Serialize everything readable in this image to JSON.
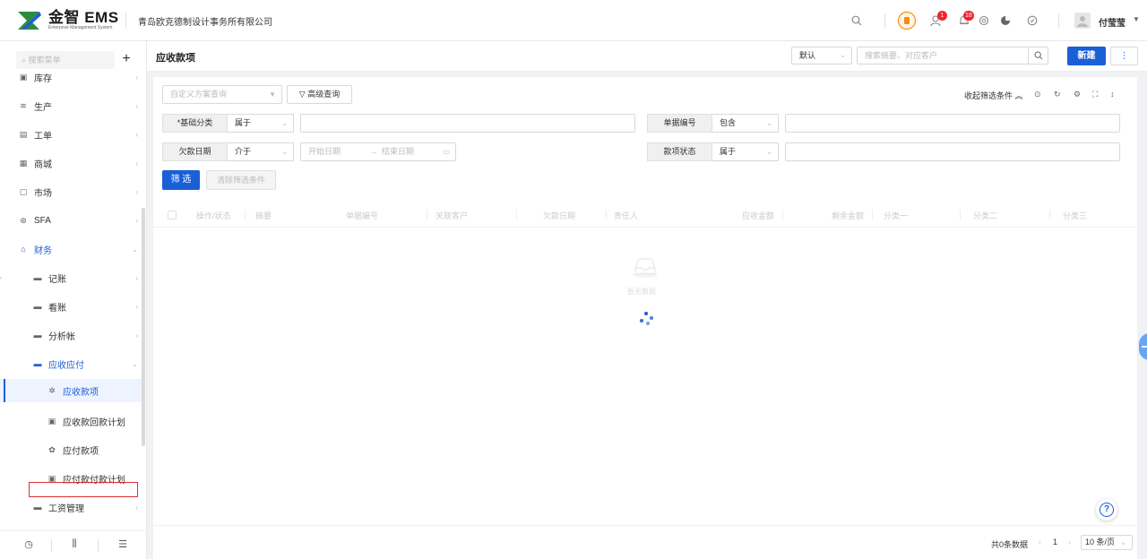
{
  "app": {
    "brand_name": "金智 EMS",
    "brand_sub": "Enterprise Management System",
    "company": "青岛欧克德制设计事务所有限公司",
    "accent_color": "#1a5fd6"
  },
  "topbar": {
    "badge_messages": "1",
    "badge_notifications": "18",
    "user_name": "付莹莹",
    "icons": [
      "search-icon",
      "plugin-icon",
      "message-icon",
      "bell-icon",
      "settings-icon",
      "pie-chart-icon",
      "shield-icon",
      "user-avatar"
    ]
  },
  "sidebar": {
    "search_placeholder": "搜索菜单",
    "add_label": "+",
    "items": [
      {
        "label": "库存",
        "icon": "inventory-icon"
      },
      {
        "label": "生产",
        "icon": "production-icon"
      },
      {
        "label": "工单",
        "icon": "workorder-icon"
      },
      {
        "label": "商城",
        "icon": "mall-icon"
      },
      {
        "label": "市场",
        "icon": "market-icon"
      },
      {
        "label": "SFA",
        "icon": "sfa-icon"
      },
      {
        "label": "财务",
        "icon": "finance-icon"
      },
      {
        "label": "记账",
        "icon": "folder-icon"
      },
      {
        "label": "看账",
        "icon": "folder-icon"
      },
      {
        "label": "分析帐",
        "icon": "folder-icon"
      },
      {
        "label": "应收应付",
        "icon": "folder-icon"
      },
      {
        "label": "应收款项",
        "icon": "gear-icon"
      },
      {
        "label": "应收款回款计划",
        "icon": "calendar-icon"
      },
      {
        "label": "应付款项",
        "icon": "gear-icon"
      },
      {
        "label": "应付款付款计划",
        "icon": "calendar-icon"
      },
      {
        "label": "工资管理",
        "icon": "folder-icon"
      }
    ],
    "bottom_icons": [
      "history-icon",
      "filter-settings-icon",
      "collapse-menu-icon"
    ]
  },
  "header": {
    "title": "应收款项",
    "view_select": "默认",
    "search_placeholder": "搜索摘要、对应客户",
    "new_button": "新建",
    "more_button": "⋮"
  },
  "filters": {
    "saved_query_placeholder": "自定义方案查询",
    "advanced_query": "高级查询",
    "collapse_label": "收起筛选条件",
    "rows": [
      {
        "label": "*基础分类",
        "op": "属于"
      },
      {
        "label": "单据编号",
        "op": "包含"
      },
      {
        "label": "欠款日期",
        "op": "介于",
        "start_placeholder": "开始日期",
        "end_placeholder": "结束日期"
      },
      {
        "label": "款项状态",
        "op": "属于"
      }
    ],
    "filter_button": "筛 选",
    "clear_button": "清除筛选条件"
  },
  "table": {
    "columns": [
      "操作/状态",
      "摘要",
      "单据编号",
      "关联客户",
      "欠款日期",
      "责任人",
      "应收金额",
      "剩余金额",
      "分类一",
      "分类二",
      "分类三"
    ],
    "empty_text": "暂无数据"
  },
  "footer": {
    "total": "共0条数据",
    "page": "1",
    "page_size": "10 条/页"
  }
}
